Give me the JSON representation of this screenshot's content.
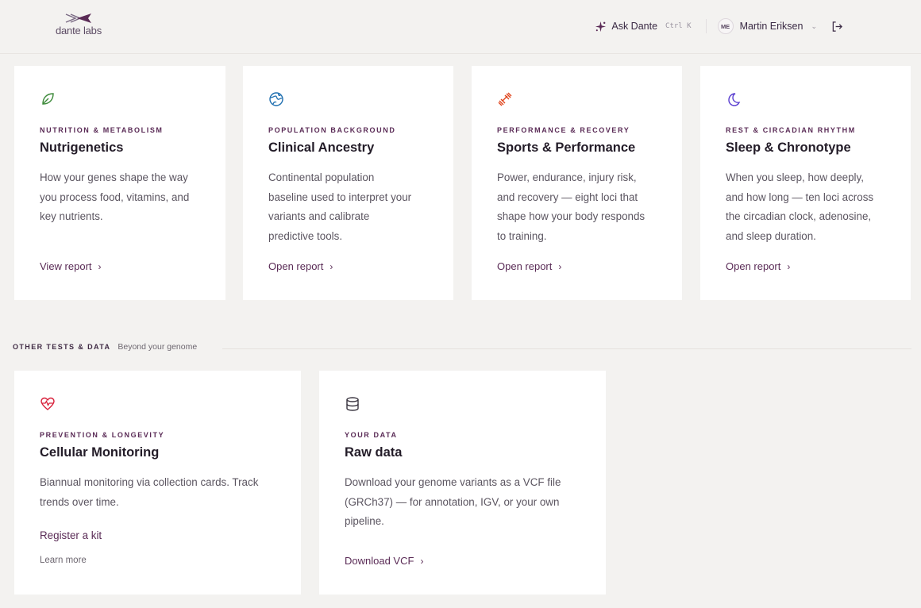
{
  "brand": {
    "name": "dante labs"
  },
  "header": {
    "ask_label": "Ask Dante",
    "ask_shortcut": "Ctrl K",
    "user_initials": "ME",
    "user_name": "Martin Eriksen"
  },
  "reports": [
    {
      "eyebrow": "NUTRITION & METABOLISM",
      "title": "Nutrigenetics",
      "desc_lines": [
        "How your genes shape the way",
        "you process food, vitamins, and",
        "key nutrients."
      ],
      "link": "View report",
      "icon": "leaf-icon",
      "color": "#3d8a3a"
    },
    {
      "eyebrow": "POPULATION BACKGROUND",
      "title": "Clinical Ancestry",
      "desc_lines": [
        "Continental population",
        "baseline used to interpret your",
        "variants and calibrate",
        "predictive tools."
      ],
      "link": "Open report",
      "icon": "globe-icon",
      "color": "#1f6fb0"
    },
    {
      "eyebrow": "PERFORMANCE & RECOVERY",
      "title": "Sports & Performance",
      "desc_lines": [
        "Power, endurance, injury risk,",
        "and recovery — eight loci that",
        "shape how your body responds",
        "to training."
      ],
      "link": "Open report",
      "icon": "dumbbell-icon",
      "color": "#e0441c"
    },
    {
      "eyebrow": "REST & CIRCADIAN RHYTHM",
      "title": "Sleep & Chronotype",
      "desc_lines": [
        "When you sleep, how deeply,",
        "and how long — ten loci across",
        "the circadian clock, adenosine,",
        "and sleep duration."
      ],
      "link": "Open report",
      "icon": "moon-icon",
      "color": "#5a3fd0"
    }
  ],
  "other_section": {
    "label": "OTHER TESTS & DATA",
    "sublabel": "Beyond your genome"
  },
  "other": [
    {
      "eyebrow": "PREVENTION & LONGEVITY",
      "title": "Cellular Monitoring",
      "desc_lines": [
        "Biannual monitoring via collection cards. Track",
        "trends over time."
      ],
      "primary": "Register a kit",
      "secondary": "Learn more",
      "icon": "heart-pulse-icon",
      "color": "#d8203a"
    },
    {
      "eyebrow": "YOUR DATA",
      "title": "Raw data",
      "desc_lines": [
        "Download your genome variants as a VCF file",
        "(GRCh37) — for annotation, IGV, or your own",
        "pipeline."
      ],
      "link": "Download VCF",
      "icon": "database-icon",
      "color": "#3a3540"
    }
  ]
}
